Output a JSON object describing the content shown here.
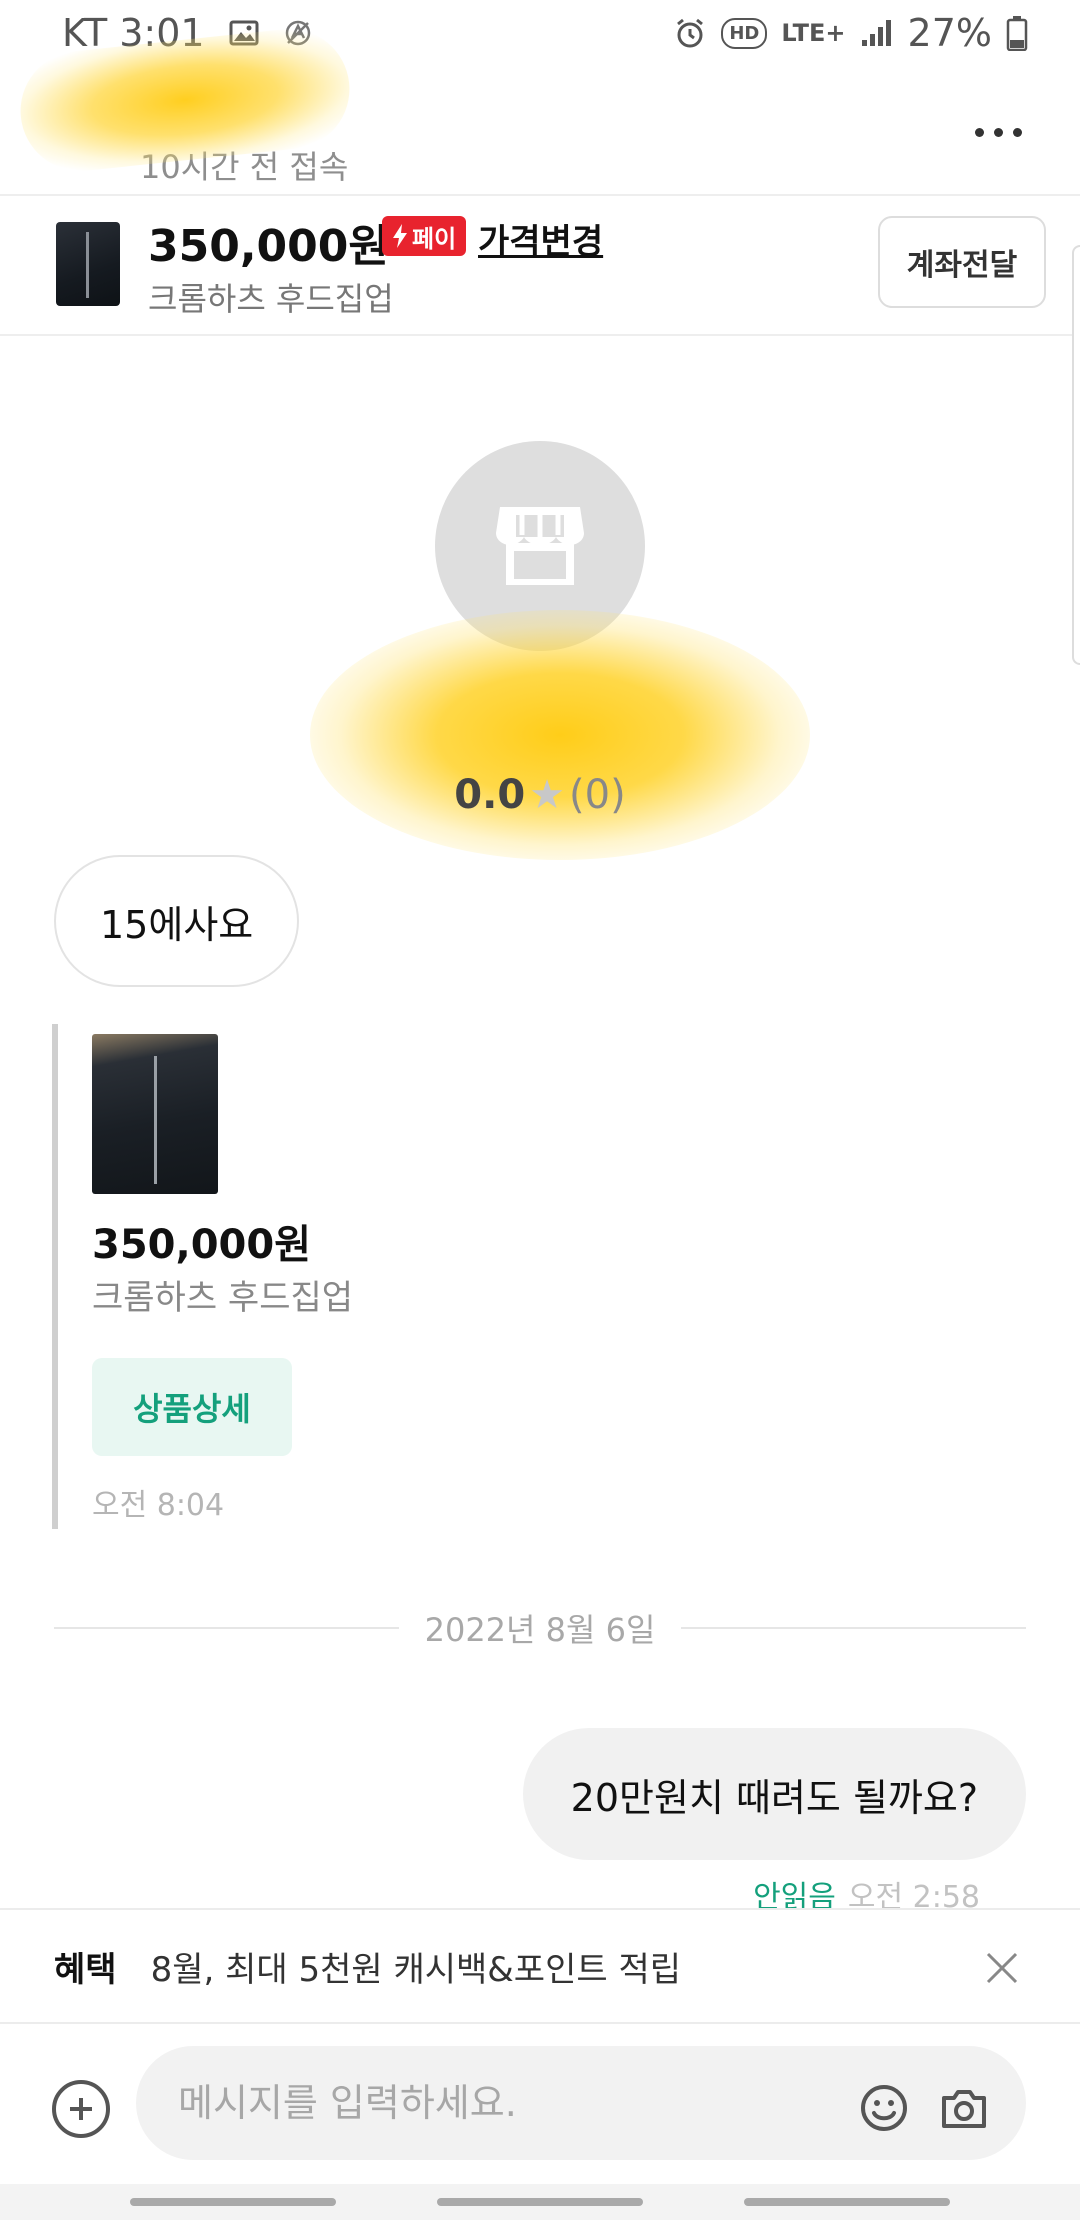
{
  "status_bar": {
    "carrier_time": "KT 3:01",
    "network": "LTE+",
    "hd": "HD",
    "battery": "27%"
  },
  "header": {
    "seller_name": "",
    "last_seen": "10시간 전 접속"
  },
  "product": {
    "price": "350,000원",
    "pay_badge": "페이",
    "price_change": "가격변경",
    "name": "크롬하츠 후드집업",
    "account_button": "계좌전달"
  },
  "profile": {
    "rating": "0.0",
    "review_count": "(0)"
  },
  "messages": {
    "incoming_text": "15에사요",
    "card": {
      "price": "350,000원",
      "name": "크롬하츠 후드집업",
      "detail_button": "상품상세",
      "time": "오전 8:04"
    },
    "date_divider": "2022년 8월 6일",
    "outgoing_text": "20만원치 때려도 될까요?",
    "outgoing_status": "안읽음",
    "outgoing_time": "오전 2:58"
  },
  "benefit": {
    "tag": "혜택",
    "text": "8월, 최대 5천원 캐시백&포인트 적립"
  },
  "input": {
    "placeholder": "메시지를 입력하세요."
  },
  "colors": {
    "accent_green": "#14a07c",
    "pay_red": "#e8232e",
    "redaction_yellow": "#ffcc14"
  },
  "icons": [
    "image-icon",
    "accessibility-icon",
    "alarm-icon",
    "signal-icon",
    "battery-icon",
    "more-icon",
    "bolt-icon",
    "store-icon",
    "star-icon",
    "close-icon",
    "plus-icon",
    "emoji-icon",
    "camera-icon"
  ]
}
